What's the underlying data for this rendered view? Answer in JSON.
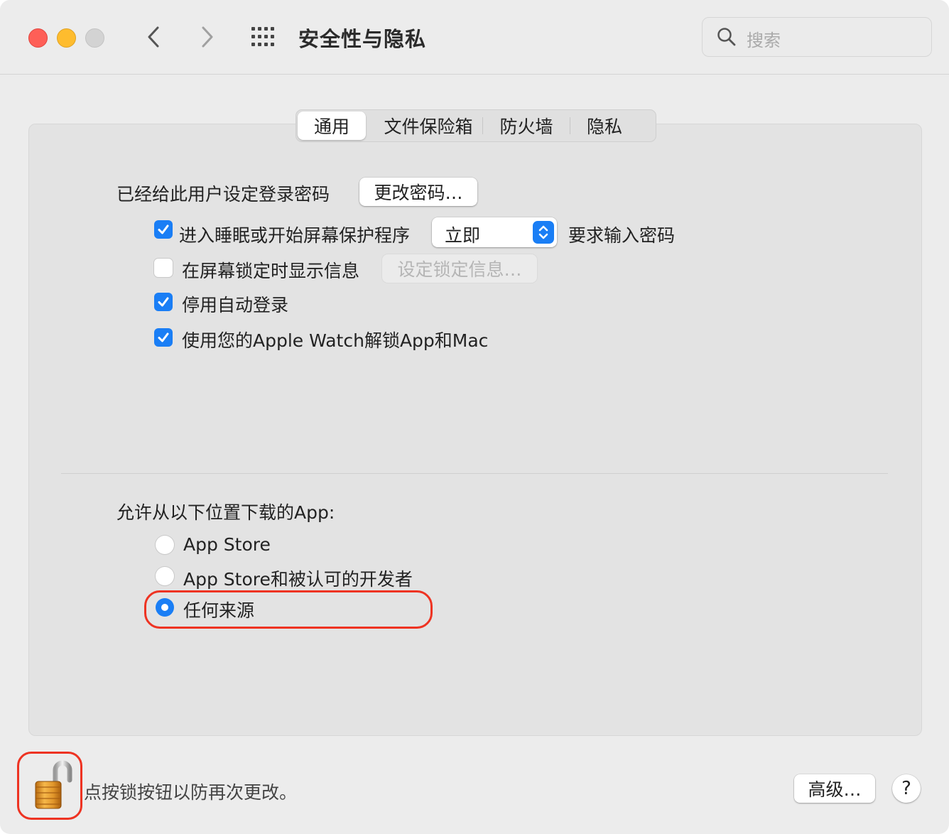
{
  "window": {
    "title": "安全性与隐私",
    "search_placeholder": "搜索"
  },
  "tabs": [
    {
      "label": "通用",
      "active": true
    },
    {
      "label": "文件保险箱",
      "active": false
    },
    {
      "label": "防火墙",
      "active": false
    },
    {
      "label": "隐私",
      "active": false
    }
  ],
  "general": {
    "password_set_label": "已经给此用户设定登录密码",
    "change_password_button": "更改密码…",
    "require_password": {
      "checked": true,
      "prefix": "进入睡眠或开始屏幕保护程序",
      "select_value": "立即",
      "suffix": "要求输入密码"
    },
    "show_message": {
      "checked": false,
      "label": "在屏幕锁定时显示信息",
      "button": "设定锁定信息…"
    },
    "disable_auto_login": {
      "checked": true,
      "label": "停用自动登录"
    },
    "apple_watch_unlock": {
      "checked": true,
      "label": "使用您的Apple Watch解锁App和Mac"
    }
  },
  "downloads": {
    "heading": "允许从以下位置下载的App:",
    "options": [
      {
        "label": "App Store",
        "selected": false
      },
      {
        "label": "App Store和被认可的开发者",
        "selected": false
      },
      {
        "label": "任何来源",
        "selected": true
      }
    ]
  },
  "footer": {
    "lock_text": "点按锁按钮以防再次更改。",
    "advanced_button": "高级…",
    "help_button": "?"
  },
  "colors": {
    "accent": "#1a7ef5",
    "annotation": "#ee3322"
  }
}
